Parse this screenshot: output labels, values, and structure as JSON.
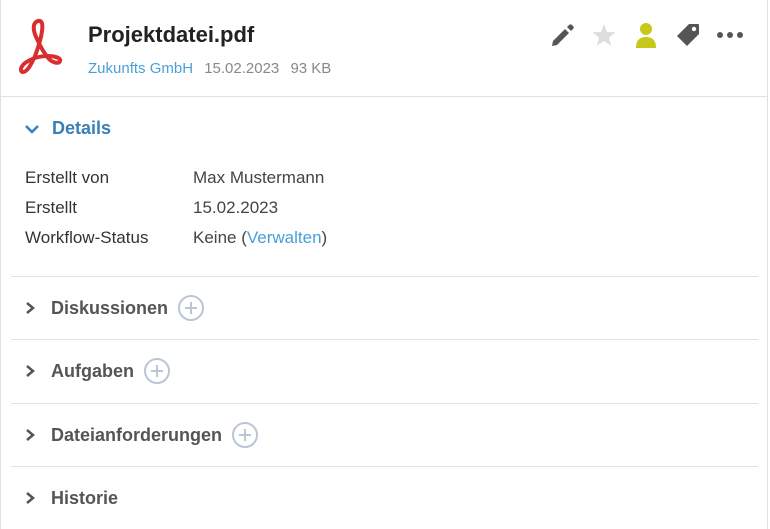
{
  "header": {
    "file_name": "Projektdatei.pdf",
    "company": "Zukunfts GmbH",
    "date": "15.02.2023",
    "size": "93 KB",
    "file_icon": "pdf-icon",
    "actions": [
      "edit-icon",
      "star-icon",
      "user-icon",
      "tag-icon",
      "more-icon"
    ],
    "colors": {
      "link": "#4a9fd8",
      "user_icon": "#c8c81a",
      "pdf": "#d92e2e"
    }
  },
  "details": {
    "title": "Details",
    "rows": [
      {
        "label": "Erstellt von",
        "value": "Max Mustermann"
      },
      {
        "label": "Erstellt",
        "value": "15.02.2023"
      },
      {
        "label": "Workflow-Status",
        "value": "Keine (",
        "link": "Verwalten",
        "suffix": ")"
      }
    ]
  },
  "sections": {
    "discussions": "Diskussionen",
    "tasks": "Aufgaben",
    "file_requests": "Dateianforderungen",
    "history": "Historie"
  }
}
